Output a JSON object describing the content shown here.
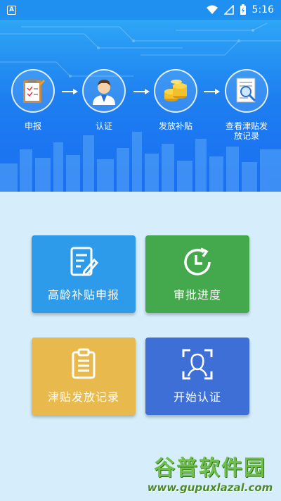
{
  "status_bar": {
    "app_icon": "A",
    "time": "5:16",
    "icons": [
      "wifi-icon",
      "signal-icon",
      "battery-icon"
    ]
  },
  "header": {
    "steps": [
      {
        "label": "申报",
        "icon": "clipboard-icon"
      },
      {
        "label": "认证",
        "icon": "person-icon"
      },
      {
        "label": "发放补贴",
        "icon": "coins-icon"
      },
      {
        "label": "查看津贴发放记录",
        "icon": "document-search-icon"
      }
    ]
  },
  "tiles": [
    {
      "label": "高龄补贴申报",
      "icon": "edit-document-icon",
      "color": "#2e9bea"
    },
    {
      "label": "审批进度",
      "icon": "clock-refresh-icon",
      "color": "#44a84c"
    },
    {
      "label": "津贴发放记录",
      "icon": "clipboard-list-icon",
      "color": "#e8b94c"
    },
    {
      "label": "开始认证",
      "icon": "face-scan-icon",
      "color": "#3d6fd6"
    }
  ],
  "watermark": {
    "title": "谷普软件园",
    "url": "www.gupuxlazal.com"
  },
  "colors": {
    "banner_top": "#2ea6f6",
    "banner_bottom": "#1a6ef2",
    "page_background": "#d6eefb"
  }
}
